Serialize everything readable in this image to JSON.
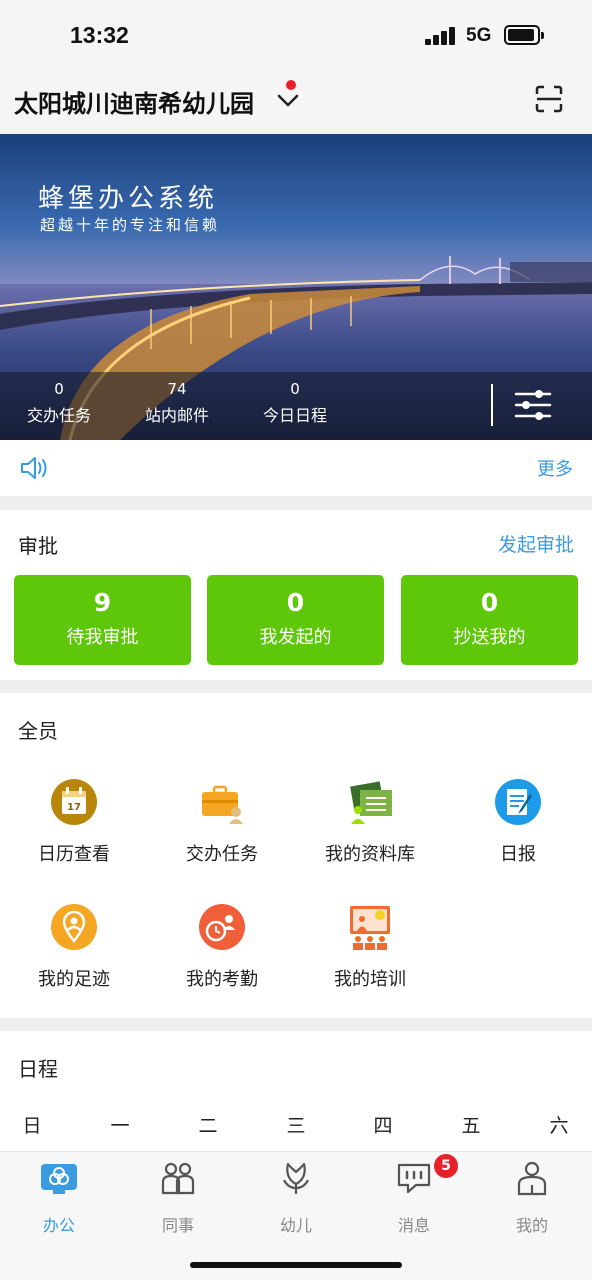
{
  "status_bar": {
    "time": "13:32",
    "network": "5G"
  },
  "header": {
    "school_name": "太阳城川迪南希幼儿园"
  },
  "banner": {
    "title": "蜂堡办公系统",
    "subtitle": "超越十年的专注和信赖",
    "stats": [
      {
        "value": "0",
        "label": "交办任务"
      },
      {
        "value": "74",
        "label": "站内邮件"
      },
      {
        "value": "0",
        "label": "今日日程"
      }
    ]
  },
  "announce": {
    "more": "更多"
  },
  "approval": {
    "title": "审批",
    "start": "发起审批",
    "cards": [
      {
        "value": "9",
        "label": "待我审批"
      },
      {
        "value": "0",
        "label": "我发起的"
      },
      {
        "value": "0",
        "label": "抄送我的"
      }
    ]
  },
  "all_staff": {
    "title": "全员",
    "apps": [
      {
        "label": "日历查看",
        "icon": "calendar-icon"
      },
      {
        "label": "交办任务",
        "icon": "briefcase-icon"
      },
      {
        "label": "我的资料库",
        "icon": "library-icon"
      },
      {
        "label": "日报",
        "icon": "daily-report-icon"
      },
      {
        "label": "我的足迹",
        "icon": "footprint-icon"
      },
      {
        "label": "我的考勤",
        "icon": "attendance-icon"
      },
      {
        "label": "我的培训",
        "icon": "training-icon"
      }
    ],
    "calendar_day": "17"
  },
  "schedule": {
    "title": "日程",
    "weekdays": [
      "日",
      "一",
      "二",
      "三",
      "四",
      "五",
      "六"
    ]
  },
  "tabbar": {
    "tabs": [
      {
        "label": "办公",
        "icon": "office-icon"
      },
      {
        "label": "同事",
        "icon": "colleagues-icon"
      },
      {
        "label": "幼儿",
        "icon": "children-icon"
      },
      {
        "label": "消息",
        "icon": "message-icon",
        "badge": "5"
      },
      {
        "label": "我的",
        "icon": "profile-icon"
      }
    ]
  },
  "colors": {
    "accent": "#3a9be0",
    "approval_green": "#5fc70a",
    "badge_red": "#e8202a"
  }
}
